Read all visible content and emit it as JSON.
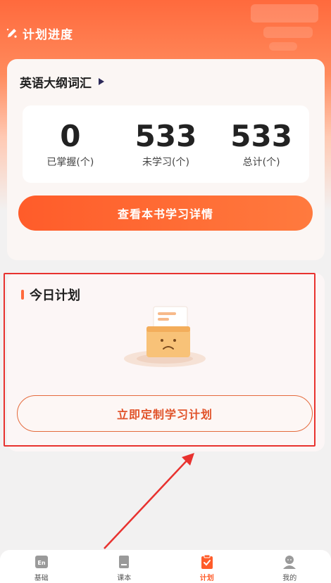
{
  "header": {
    "title": "计划进度"
  },
  "book": {
    "name": "英语大纲词汇",
    "stats": [
      {
        "value": "0",
        "label": "已掌握(个)"
      },
      {
        "value": "533",
        "label": "未学习(个)"
      },
      {
        "value": "533",
        "label": "总计(个)"
      }
    ],
    "detail_button": "查看本书学习详情"
  },
  "today_plan": {
    "title": "今日计划",
    "make_plan_button": "立即定制学习计划"
  },
  "tabbar": {
    "items": [
      {
        "label": "基础",
        "icon": "en-book-icon",
        "active": false
      },
      {
        "label": "课本",
        "icon": "textbook-icon",
        "active": false
      },
      {
        "label": "计划",
        "icon": "clipboard-check-icon",
        "active": true
      },
      {
        "label": "我的",
        "icon": "profile-icon",
        "active": false
      }
    ]
  },
  "colors": {
    "accent": "#ff5c2a",
    "highlight_box": "#e8322f",
    "annotation_arrow": "#e8322f"
  }
}
